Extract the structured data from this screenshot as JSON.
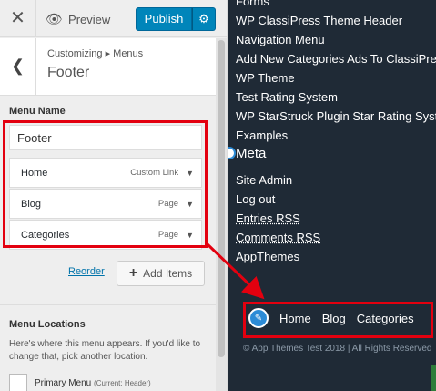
{
  "topbar": {
    "close_glyph": "✕",
    "preview_label": "Preview",
    "publish_label": "Publish",
    "gear_glyph": "⚙"
  },
  "section": {
    "breadcrumb": "Customizing ▸ Menus",
    "title": "Footer",
    "back_glyph": "❮"
  },
  "menu_name": {
    "label": "Menu Name",
    "value": "Footer"
  },
  "menu_items": [
    {
      "title": "Home",
      "type": "Custom Link"
    },
    {
      "title": "Blog",
      "type": "Page"
    },
    {
      "title": "Categories",
      "type": "Page"
    }
  ],
  "actions": {
    "reorder": "Reorder",
    "add_items": "Add Items"
  },
  "locations": {
    "title": "Menu Locations",
    "description": "Here's where this menu appears. If you'd like to change that, pick another location.",
    "primary": "Primary Menu",
    "primary_sub": "(Current: Header)"
  },
  "preview": {
    "links_top": [
      "Forms",
      "WP ClassiPress Theme Header",
      "Navigation Menu",
      "Add New Categories Ads To ClassiPress",
      "WP Theme",
      "Test Rating System",
      "WP StarStruck Plugin Star Rating System",
      "Examples"
    ],
    "meta_heading": "Meta",
    "meta_links": [
      "Site Admin",
      "Log out",
      "Entries RSS",
      "Comments RSS",
      "AppThemes"
    ],
    "footer_menu": [
      "Home",
      "Blog",
      "Categories"
    ],
    "copyright": "© App Themes Test 2018 | All Rights Reserved"
  },
  "colors": {
    "accent": "#0085ba",
    "annotation": "#e3000f",
    "preview_bg": "#1f2a36"
  }
}
